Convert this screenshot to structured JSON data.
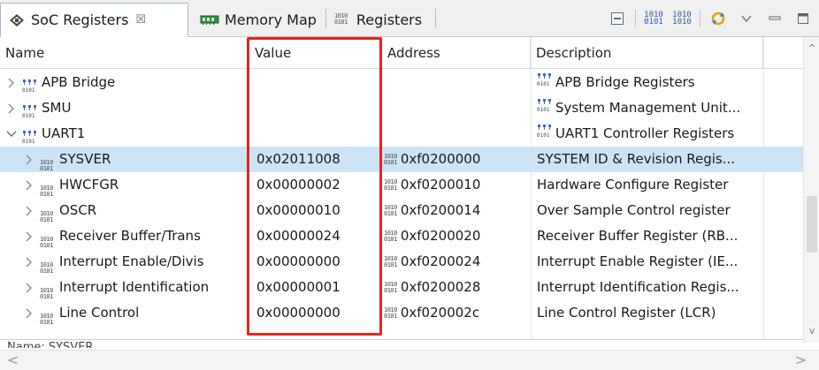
{
  "tabs": [
    {
      "label": "SoC Registers",
      "close": "☒",
      "active": true
    },
    {
      "label": "Memory Map",
      "active": false
    },
    {
      "label": "Registers",
      "active": false
    }
  ],
  "toolbar": {
    "bits1": [
      "1010",
      "0101"
    ],
    "bits2": [
      "1010",
      "1010"
    ]
  },
  "columns": {
    "name": "Name",
    "value": "Value",
    "address": "Address",
    "description": "Description"
  },
  "rows": [
    {
      "name": "APB Bridge",
      "value": "",
      "address": "",
      "description": "APB Bridge Registers",
      "kind": "group",
      "expanded": false,
      "indent": 0,
      "selected": false
    },
    {
      "name": "SMU",
      "value": "",
      "address": "",
      "description": "System Management Unit...",
      "kind": "group",
      "expanded": false,
      "indent": 0,
      "selected": false
    },
    {
      "name": "UART1",
      "value": "",
      "address": "",
      "description": "UART1 Controller Registers",
      "kind": "group",
      "expanded": true,
      "indent": 0,
      "selected": false
    },
    {
      "name": "SYSVER",
      "value": "0x02011008",
      "address": "0xf0200000",
      "description": "SYSTEM ID & Revision Regis...",
      "kind": "reg",
      "expanded": false,
      "indent": 1,
      "selected": true
    },
    {
      "name": "HWCFGR",
      "value": "0x00000002",
      "address": "0xf0200010",
      "description": "Hardware Configure Register",
      "kind": "reg",
      "expanded": false,
      "indent": 1,
      "selected": false
    },
    {
      "name": "OSCR",
      "value": "0x00000010",
      "address": "0xf0200014",
      "description": "Over Sample Control register",
      "kind": "reg",
      "expanded": false,
      "indent": 1,
      "selected": false
    },
    {
      "name": "Receiver Buffer/Trans",
      "value": "0x00000024",
      "address": "0xf0200020",
      "description": "Receiver Buffer Register (RB...",
      "kind": "reg",
      "expanded": false,
      "indent": 1,
      "selected": false
    },
    {
      "name": "Interrupt Enable/Divis",
      "value": "0x00000000",
      "address": "0xf0200024",
      "description": "Interrupt Enable Register (IE...",
      "kind": "reg",
      "expanded": false,
      "indent": 1,
      "selected": false
    },
    {
      "name": "Interrupt Identification",
      "value": "0x00000001",
      "address": "0xf0200028",
      "description": "Interrupt Identification Regis...",
      "kind": "reg",
      "expanded": false,
      "indent": 1,
      "selected": false
    },
    {
      "name": "Line Control",
      "value": "0x00000000",
      "address": "0xf020002c",
      "description": "Line Control Register (LCR)",
      "kind": "reg",
      "expanded": false,
      "indent": 1,
      "selected": false
    }
  ],
  "status": {
    "text": "Name: SYSVER"
  },
  "colors": {
    "highlight": "#e8231f",
    "selection": "#cde4f7",
    "group_icon": "#3b6cc4"
  }
}
